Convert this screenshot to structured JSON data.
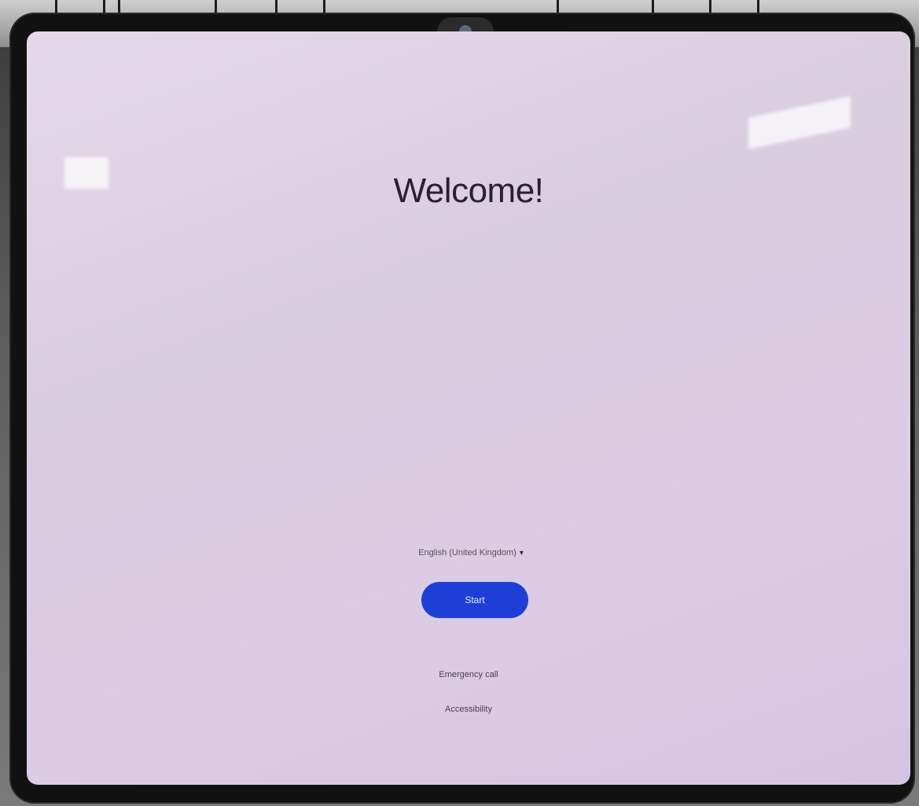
{
  "screen": {
    "title": "Welcome!",
    "language_selector": {
      "value": "English (United Kingdom)",
      "caret_icon": "caret-down-icon"
    },
    "start_button": {
      "label": "Start"
    },
    "links": {
      "emergency_call": "Emergency call",
      "accessibility": "Accessibility"
    }
  },
  "colors": {
    "accent": "#1d3fd6",
    "screen_background": "#dccbe4"
  }
}
